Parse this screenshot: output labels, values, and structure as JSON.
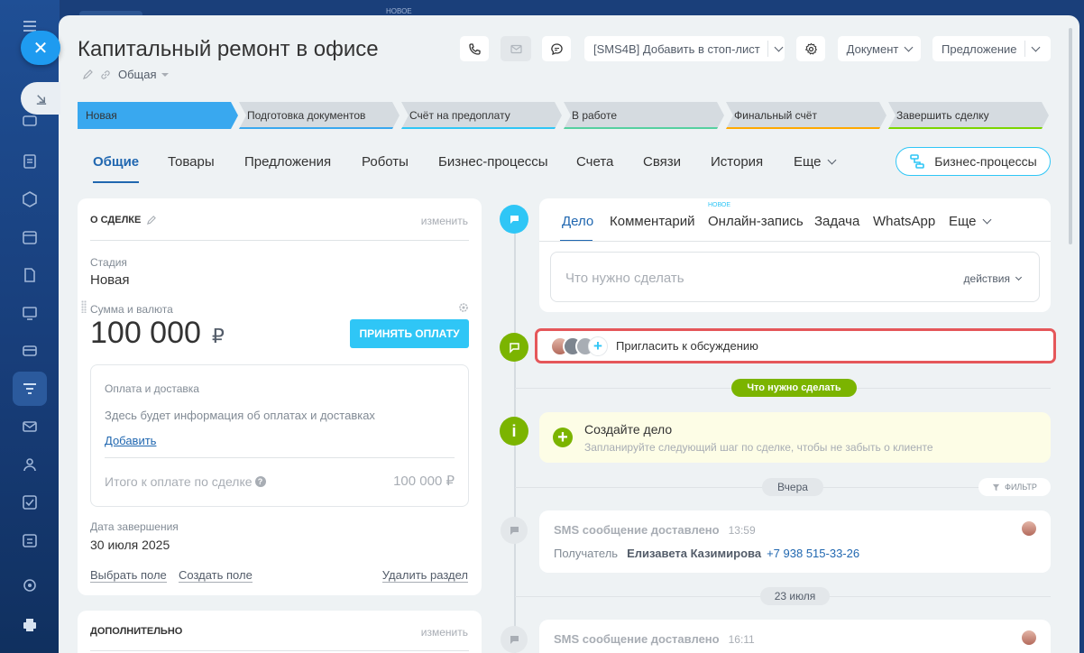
{
  "window": {
    "top_new_badge": "НОВОЕ"
  },
  "header": {
    "title": "Капитальный ремонт в офисе",
    "category": "Общая",
    "sms_action": "[SMS4B] Добавить в стоп-лист",
    "document_btn": "Документ",
    "proposal_btn": "Предложение"
  },
  "stages": [
    {
      "label": "Новая",
      "color": "#39a8ef",
      "line": "#39a8ef",
      "active": true
    },
    {
      "label": "Подготовка документов",
      "color": "#d5dbe0",
      "line": "#39a8ef"
    },
    {
      "label": "Счёт на предоплату",
      "color": "#d5dbe0",
      "line": "#2fc6f6"
    },
    {
      "label": "В работе",
      "color": "#d5dbe0",
      "line": "#55d0a0"
    },
    {
      "label": "Финальный счёт",
      "color": "#d5dbe0",
      "line": "#ffa900"
    },
    {
      "label": "Завершить сделку",
      "color": "#d5dbe0",
      "line": "#7bd500"
    }
  ],
  "tabs": [
    "Общие",
    "Товары",
    "Предложения",
    "Роботы",
    "Бизнес-процессы",
    "Счета",
    "Связи",
    "История",
    "Еще"
  ],
  "bp_button": "Бизнес-процессы",
  "deal": {
    "section_title": "О СДЕЛКЕ",
    "edit": "изменить",
    "stage_label": "Стадия",
    "stage_value": "Новая",
    "amount_label": "Сумма и валюта",
    "amount": "100 000",
    "currency": "₽",
    "pay_btn": "ПРИНЯТЬ ОПЛАТУ",
    "payments_title": "Оплата и доставка",
    "payments_hint": "Здесь будет информация об оплатах и доставках",
    "add_link": "Добавить",
    "total_label": "Итого к оплате по сделке",
    "total_value": "100 000 ₽",
    "close_label": "Дата завершения",
    "close_value": "30 июля 2025",
    "choose_field": "Выбрать поле",
    "create_field": "Создать поле",
    "delete_section": "Удалить раздел"
  },
  "extra": {
    "section_title": "ДОПОЛНИТЕЛЬНО",
    "edit": "изменить"
  },
  "timeline_tabs": {
    "new_badge": "НОВОЕ",
    "items": [
      "Дело",
      "Комментарий",
      "Онлайн-запись",
      "Задача",
      "WhatsApp",
      "Еще"
    ],
    "input_placeholder": "Что нужно сделать",
    "actions": "действия"
  },
  "invite": "Пригласить к обсуждению",
  "todo_pill": "Что нужно сделать",
  "create_task": {
    "title": "Создайте дело",
    "hint": "Запланируйте следующий шаг по сделке, чтобы не забыть о клиенте"
  },
  "yesterday": "Вчера",
  "filter": "ФИЛЬТР",
  "sms1": {
    "title": "SMS сообщение доставлено",
    "time": "13:59",
    "recipient_label": "Получатель",
    "recipient": "Елизавета Казимирова",
    "phone": "+7 938 515-33-26"
  },
  "date2": "23 июля",
  "sms2": {
    "title": "SMS сообщение доставлено",
    "time": "16:11"
  }
}
